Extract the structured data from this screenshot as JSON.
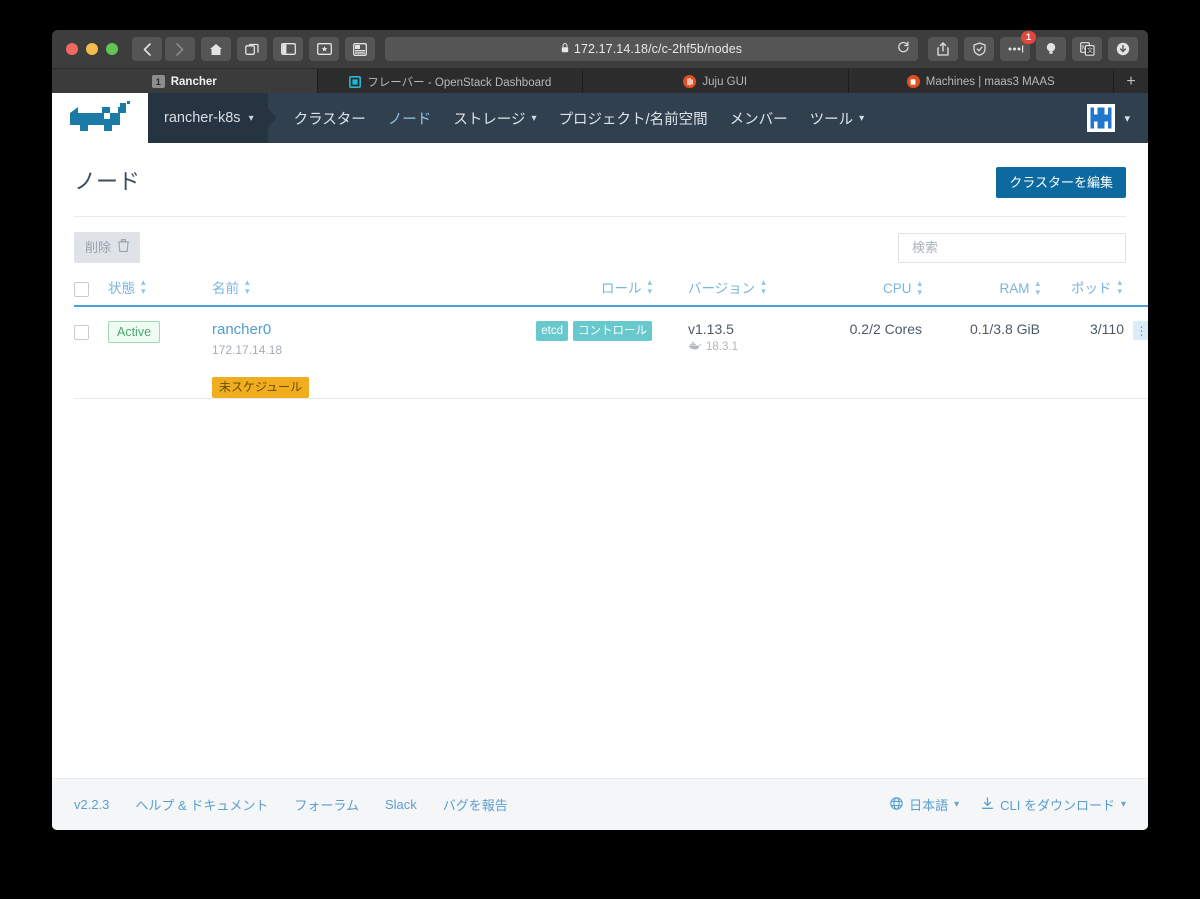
{
  "browser": {
    "url": "172.17.14.18/c/c-2hf5b/nodes",
    "lock_icon": "lock-icon",
    "buttons": {
      "back": "back-icon",
      "forward": "forward-icon",
      "home": "home-icon",
      "tabs_overview": "tab-overview-icon",
      "sidebar": "sidebar-icon",
      "reading_list": "reading-list-icon",
      "tab_groups": "tab-groups-icon",
      "reload": "reload-icon",
      "share": "share-icon",
      "shield": "shield-icon",
      "extension_more": "more-dots-icon",
      "bulb": "lightbulb-icon",
      "translate": "translate-icon",
      "download": "download-icon",
      "new_tab": "plus-icon"
    },
    "extension_badge_count": "1",
    "tabs": [
      {
        "title": "Rancher",
        "favicon": "number-badge-icon",
        "favicon_text": "1",
        "active": true
      },
      {
        "title": "フレーバー - OpenStack Dashboard",
        "favicon": "openstack-icon",
        "favicon_text": "",
        "active": false
      },
      {
        "title": "Juju GUI",
        "favicon": "juju-icon",
        "favicon_text": "",
        "active": false
      },
      {
        "title": "Machines | maas3 MAAS",
        "favicon": "maas-icon",
        "favicon_text": "",
        "active": false
      }
    ]
  },
  "topnav": {
    "logo": "rancher-cow-logo",
    "cluster_name": "rancher-k8s",
    "cluster_caret": "chevron-down-icon",
    "links": [
      {
        "label": "クラスター",
        "active": false,
        "caret": false
      },
      {
        "label": "ノード",
        "active": true,
        "caret": false
      },
      {
        "label": "ストレージ",
        "active": false,
        "caret": true
      },
      {
        "label": "プロジェクト/名前空間",
        "active": false,
        "caret": false
      },
      {
        "label": "メンバー",
        "active": false,
        "caret": false
      },
      {
        "label": "ツール",
        "active": false,
        "caret": true
      }
    ],
    "avatar": "user-avatar-icon",
    "avatar_caret": "chevron-down-icon"
  },
  "page": {
    "title": "ノード",
    "edit_cluster_button": "クラスターを編集",
    "delete_button": "削除",
    "delete_icon": "trash-icon",
    "search_placeholder": "検索",
    "search_value": ""
  },
  "table": {
    "columns": [
      {
        "key": "check",
        "label": "",
        "sortable": false
      },
      {
        "key": "state",
        "label": "状態",
        "sortable": true
      },
      {
        "key": "name",
        "label": "名前",
        "sortable": true
      },
      {
        "key": "role",
        "label": "ロール",
        "sortable": true
      },
      {
        "key": "version",
        "label": "バージョン",
        "sortable": true
      },
      {
        "key": "cpu",
        "label": "CPU",
        "sortable": true
      },
      {
        "key": "ram",
        "label": "RAM",
        "sortable": true
      },
      {
        "key": "pods",
        "label": "ポッド",
        "sortable": true
      }
    ],
    "sort_icon": "sort-arrows-icon",
    "rows": [
      {
        "checked": false,
        "state": "Active",
        "name": "rancher0",
        "ip": "172.17.14.18",
        "unschedulable_label": "未スケジュール",
        "roles": [
          "etcd",
          "コントロール"
        ],
        "version": "v1.13.5",
        "docker_icon": "docker-whale-icon",
        "docker_version": "18.3.1",
        "cpu": "0.2/2 Cores",
        "ram": "0.1/3.8 GiB",
        "pods": "3/110",
        "row_menu_icon": "kebab-menu-icon"
      }
    ]
  },
  "footer": {
    "version": "v2.2.3",
    "links": [
      "ヘルプ & ドキュメント",
      "フォーラム",
      "Slack",
      "バグを報告"
    ],
    "language": {
      "icon": "globe-icon",
      "label": "日本語",
      "caret": "chevron-down-icon"
    },
    "cli": {
      "icon": "download-icon",
      "label": "CLI をダウンロード",
      "caret": "chevron-down-icon"
    }
  },
  "colors": {
    "accent_blue": "#0c6aa0",
    "nav_bg": "#31404f",
    "link_blue": "#4e9ed4",
    "role_badge": "#67c9cd",
    "warning_yellow": "#f0ad1f",
    "active_green": "#4aa96c"
  }
}
